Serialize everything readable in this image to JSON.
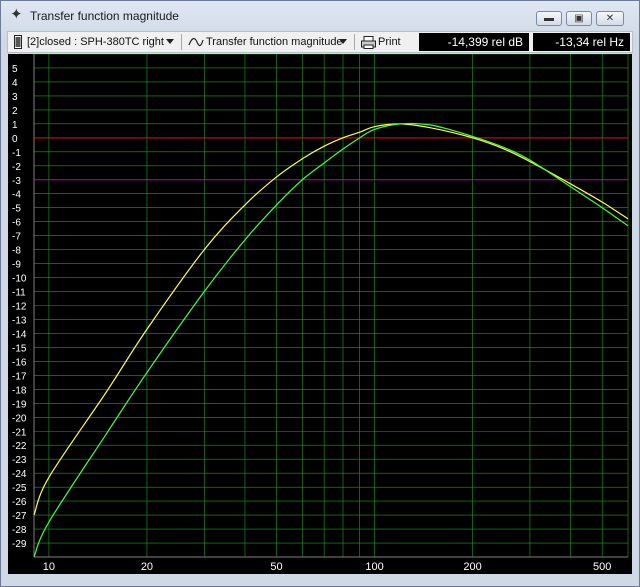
{
  "window": {
    "title": "Transfer function magnitude"
  },
  "toolbar": {
    "curve_select": "[2]closed : SPH-380TC right",
    "view_select": "Transfer function magnitude",
    "print_label": "Print",
    "readout_level": "-14,399 rel dB",
    "readout_freq": "-13,34 rel Hz"
  },
  "colors": {
    "background": "#000000",
    "grid": "#1e9e1e",
    "zero_line": "#ff0000",
    "ref_line": "#c000c0",
    "curve_yellow": "#ffff40",
    "curve_green": "#40ff40"
  },
  "chart_data": {
    "type": "line",
    "x_scale": "log",
    "xlim": [
      9,
      600
    ],
    "ylim": [
      -30,
      6
    ],
    "x_tick_labels": [
      "10",
      "20",
      "50",
      "100",
      "200",
      "500"
    ],
    "y_tick_labels": [
      "5",
      "4",
      "3",
      "2",
      "1",
      "0",
      "-1",
      "-2",
      "-3",
      "-4",
      "-5",
      "-6",
      "-7",
      "-8",
      "-9",
      "-10",
      "-11",
      "-12",
      "-13",
      "-14",
      "-15",
      "-16",
      "-17",
      "-18",
      "-19",
      "-20",
      "-21",
      "-22",
      "-23",
      "-24",
      "-25",
      "-26",
      "-27",
      "-28",
      "-29"
    ],
    "reference_lines": [
      {
        "y": 0,
        "color": "#ff0000"
      },
      {
        "y": -3,
        "color": "#c000c0"
      }
    ],
    "grid": true,
    "series": [
      {
        "color": "#ffff40",
        "x": [
          9,
          10,
          15,
          20,
          30,
          40,
          50,
          60,
          70,
          80,
          90,
          100,
          120,
          150,
          200,
          250,
          300,
          400,
          500,
          600
        ],
        "y": [
          -27,
          -24.3,
          -18.2,
          -13.7,
          -8.0,
          -4.8,
          -2.8,
          -1.5,
          -0.6,
          0.0,
          0.4,
          0.8,
          1.0,
          0.7,
          0.0,
          -0.8,
          -1.7,
          -3.3,
          -4.6,
          -5.8
        ]
      },
      {
        "color": "#40ff40",
        "x": [
          9,
          10,
          15,
          20,
          30,
          40,
          50,
          60,
          70,
          80,
          90,
          100,
          120,
          150,
          200,
          250,
          300,
          400,
          500,
          600
        ],
        "y": [
          -30,
          -27.5,
          -21.2,
          -16.8,
          -11.0,
          -7.3,
          -4.8,
          -3.0,
          -1.8,
          -0.8,
          0.0,
          0.6,
          1.0,
          0.9,
          0.1,
          -0.7,
          -1.6,
          -3.5,
          -5.0,
          -6.3
        ]
      }
    ]
  }
}
